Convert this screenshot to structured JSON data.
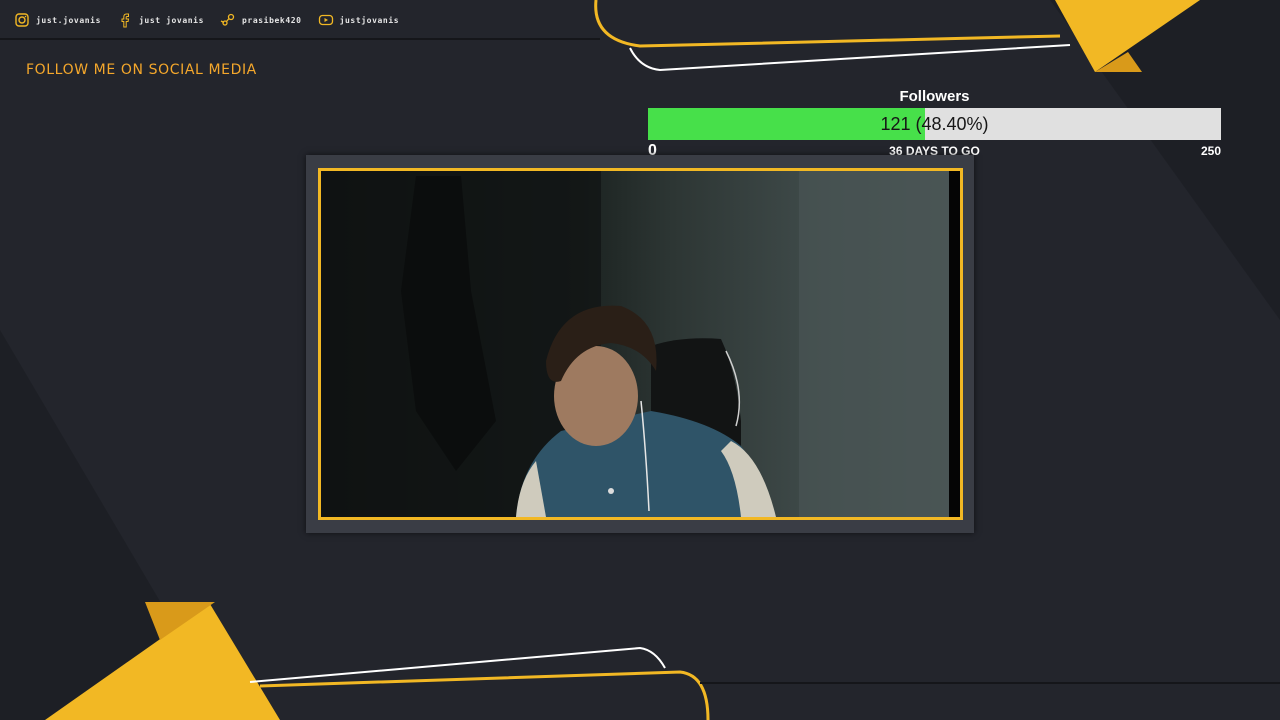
{
  "social": [
    {
      "icon": "instagram-icon",
      "label": "just.jovanis"
    },
    {
      "icon": "facebook-icon",
      "label": "just jovanis"
    },
    {
      "icon": "steam-icon",
      "label": "prasibek420"
    },
    {
      "icon": "youtube-icon",
      "label": "justjovanis"
    }
  ],
  "follow_title": "FOLLOW ME ON SOCIAL MEDIA",
  "goal": {
    "title": "Followers",
    "value_text": "121 (48.40%)",
    "current": 121,
    "target": 250,
    "progress_fraction": 0.484,
    "min_label": "0",
    "max_label": "250",
    "days_text": "36 DAYS TO GO"
  },
  "colors": {
    "accent": "#f2b824",
    "background": "#23252c",
    "goal_fill": "#47e04a",
    "goal_track": "#e0e0e0",
    "title_orange": "#f4a72b"
  }
}
